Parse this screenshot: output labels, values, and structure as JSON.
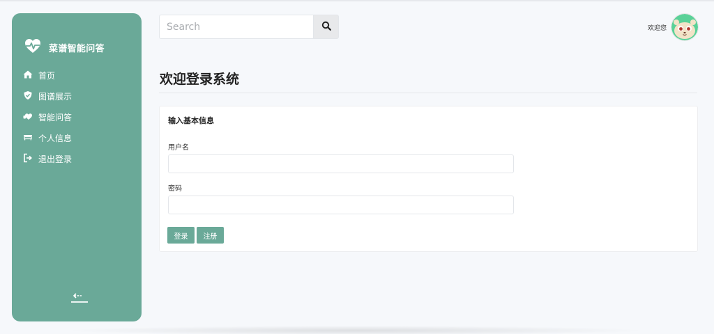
{
  "brand": {
    "name": "菜谱智能问答",
    "icon": "heartbeat-icon"
  },
  "sidebar": {
    "items": [
      {
        "label": "首页",
        "icon": "home-icon"
      },
      {
        "label": "图谱展示",
        "icon": "shield-icon"
      },
      {
        "label": "智能问答",
        "icon": "handshake-heart-icon"
      },
      {
        "label": "个人信息",
        "icon": "couch-icon"
      },
      {
        "label": "退出登录",
        "icon": "sign-out-icon"
      }
    ],
    "collapse_icon": "collapse-arrow-icon"
  },
  "header": {
    "search_placeholder": "Search",
    "search_icon": "search-icon",
    "welcome_text": "欢迎您",
    "avatar_icon": "cartoon-avatar-icon"
  },
  "main": {
    "title": "欢迎登录系统",
    "card": {
      "header": "输入基本信息",
      "username_label": "用户名",
      "username_value": "",
      "password_label": "密码",
      "password_value": "",
      "login_label": "登录",
      "register_label": "注册"
    }
  },
  "colors": {
    "accent": "#6aa998",
    "background": "#f6f8fb"
  }
}
